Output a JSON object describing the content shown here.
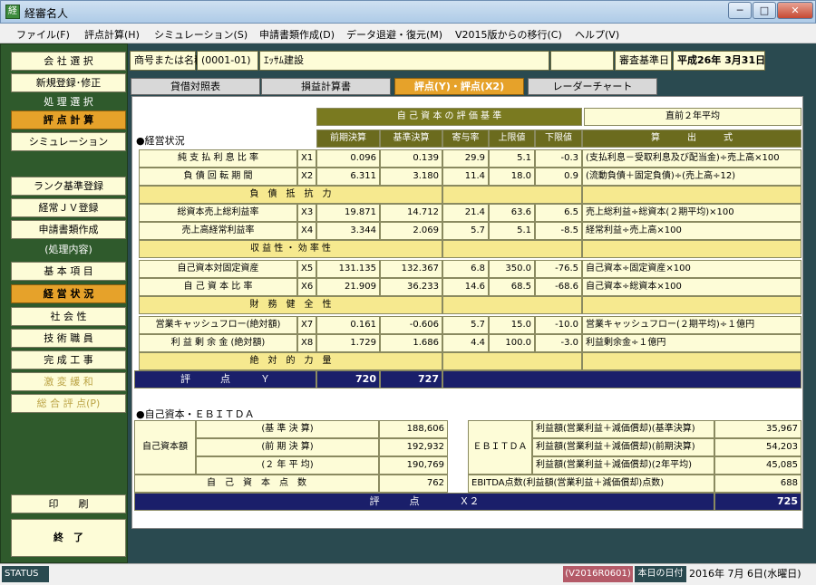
{
  "window": {
    "title": "経審名人",
    "icon": "app-icon",
    "min": "─",
    "max": "□",
    "close": "✕"
  },
  "menu": [
    "ファイル(F)",
    "評点計算(H)",
    "シミュレーション(S)",
    "申請書類作成(D)",
    "データ退避・復元(M)",
    "V2015版からの移行(C)",
    "ヘルプ(V)"
  ],
  "sidebar": {
    "company_select": "会 社 選 択",
    "new_register": "新規登録･修正",
    "process_select_header": "処 理 選 択",
    "score_calc": "評 点 計 算",
    "simulation": "シミュレーション",
    "rank_register": "ランク基準登録",
    "jv_register": "経常ＪＶ登録",
    "application_docs": "申請書類作成",
    "process_content_header": "(処理内容)",
    "basic_items": "基 本 項 目",
    "business_status": "経 営 状 況",
    "sociality": "社 会 性",
    "engineers": "技 術 職 員",
    "completed_works": "完 成 工 事",
    "mitigation": "激 変 緩 和",
    "total_score": "総 合 評 点(P)",
    "print": "印　　刷",
    "exit": "終　了"
  },
  "header": {
    "company_label": "商号または名称",
    "company_code": "(0001-01)",
    "company_name": "ｴｯｻﾑ建設",
    "base_date_label": "審査基準日",
    "base_date": "平成26年 3月31日"
  },
  "tabs": [
    "貸借対照表",
    "損益計算書",
    "評点(Y)・評点(X2)",
    "レーダーチャート"
  ],
  "grid": {
    "section_title": "●経営状況",
    "criteria_header": "自 己 資 本 の 評 価 基 準",
    "recent_avg": "直前２年平均",
    "col_prev": "前期決算",
    "col_base": "基準決算",
    "col_contrib": "寄与率",
    "col_upper": "上限値",
    "col_lower": "下限値",
    "col_formula": "算　　　出　　　式",
    "rows": [
      {
        "name": "純 支 払 利 息 比 率",
        "code": "X1",
        "prev": "0.096",
        "base": "0.139",
        "contrib": "29.9",
        "upper": "5.1",
        "lower": "-0.3",
        "formula": "(支払利息－受取利息及び配当金)÷売上高×100"
      },
      {
        "name": "負 債 回 転 期 間",
        "code": "X2",
        "prev": "6.311",
        "base": "3.180",
        "contrib": "11.4",
        "upper": "18.0",
        "lower": "0.9",
        "formula": "(流動負債＋固定負債)÷(売上高÷12)"
      },
      {
        "name": "総資本売上総利益率",
        "code": "X3",
        "prev": "19.871",
        "base": "14.712",
        "contrib": "21.4",
        "upper": "63.6",
        "lower": "6.5",
        "formula": "売上総利益÷総資本(２期平均)×100"
      },
      {
        "name": "売上高経常利益率",
        "code": "X4",
        "prev": "3.344",
        "base": "2.069",
        "contrib": "5.7",
        "upper": "5.1",
        "lower": "-8.5",
        "formula": "経常利益÷売上高×100"
      },
      {
        "name": "自己資本対固定資産",
        "code": "X5",
        "prev": "131.135",
        "base": "132.367",
        "contrib": "6.8",
        "upper": "350.0",
        "lower": "-76.5",
        "formula": "自己資本÷固定資産×100"
      },
      {
        "name": "自 己 資 本 比 率",
        "code": "X6",
        "prev": "21.909",
        "base": "36.233",
        "contrib": "14.6",
        "upper": "68.5",
        "lower": "-68.6",
        "formula": "自己資本÷総資本×100"
      },
      {
        "name": "営業キャッシュフロー(絶対額)",
        "code": "X7",
        "prev": "0.161",
        "base": "-0.606",
        "contrib": "5.7",
        "upper": "15.0",
        "lower": "-10.0",
        "formula": "営業キャッシュフロー(２期平均)÷１億円"
      },
      {
        "name": "利 益 剰 余 金 (絶対額)",
        "code": "X8",
        "prev": "1.729",
        "base": "1.686",
        "contrib": "4.4",
        "upper": "100.0",
        "lower": "-3.0",
        "formula": "利益剰余金÷１億円"
      }
    ],
    "sub1": "負　債　抵　抗　力",
    "sub2": "収 益 性 ・ 効 率 性",
    "sub3": "財　務　健　全　性",
    "sub4": "絶　対　的　力　量",
    "score_y_label": "評　　　点　　　Ｙ",
    "score_y_prev": "720",
    "score_y_base": "727"
  },
  "ebitda": {
    "section_title": "●自己資本・ＥＢＩＴＤＡ",
    "equity_label": "自己資本額",
    "base_label": "(基 準 決 算)",
    "base_val": "188,606",
    "prev_label": "(前 期 決 算)",
    "prev_val": "192,932",
    "avg_label": "(２ 年 平 均)",
    "avg_val": "190,769",
    "equity_points_label": "自　己　資　本　点　数",
    "equity_points": "762",
    "ebitda_label": "ＥＢＩＴＤＡ",
    "e_base_label": "利益額(営業利益＋減価償却)(基準決算)",
    "e_base_val": "35,967",
    "e_prev_label": "利益額(営業利益＋減価償却)(前期決算)",
    "e_prev_val": "54,203",
    "e_avg_label": "利益額(営業利益＋減価償却)(2年平均)",
    "e_avg_val": "45,085",
    "e_points_label": "EBITDA点数(利益額(営業利益＋減価償却)点数)",
    "e_points": "688",
    "x2_label": "評　　　点　　　　Ｘ２",
    "x2_val": "725"
  },
  "status": {
    "label": "STATUS",
    "version": "(V2016R0601)",
    "today_label": "本日の日付",
    "today": "2016年 7月 6日(水曜日)"
  }
}
